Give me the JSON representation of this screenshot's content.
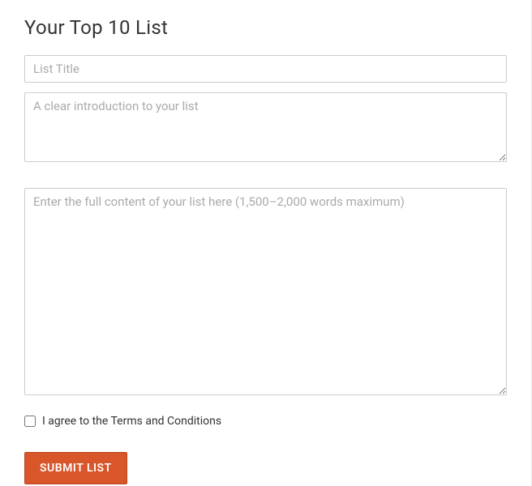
{
  "form": {
    "title": "Your Top 10 List",
    "list_title": {
      "placeholder": "List Title",
      "value": ""
    },
    "introduction": {
      "placeholder": "A clear introduction to your list",
      "value": ""
    },
    "content": {
      "placeholder": "Enter the full content of your list here (1,500–2,000 words maximum)",
      "value": ""
    },
    "terms": {
      "label": "I agree to the Terms and Conditions",
      "checked": false
    },
    "submit_label": "SUBMIT LIST"
  }
}
